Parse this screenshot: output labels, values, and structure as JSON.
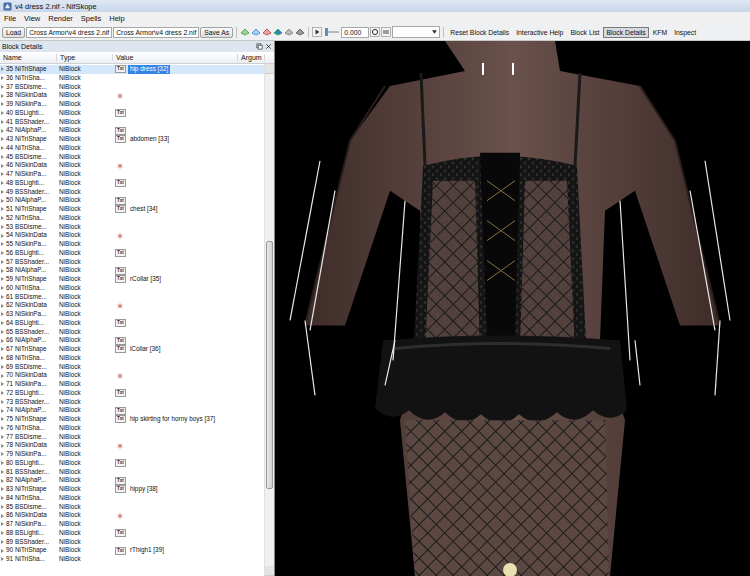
{
  "window": {
    "title": "v4 dress 2.nif - NifSkope"
  },
  "menu": [
    "File",
    "View",
    "Render",
    "Spells",
    "Help"
  ],
  "toolbar": {
    "load": "Load",
    "path": "Cross Armor\\v4 dress 2.nif",
    "path2": "Cross Armor\\v4 dress 2.nif",
    "save": "Save As",
    "time": "0.000",
    "time_level": 0,
    "views": [
      {
        "label": "Reset Block Details",
        "selected": false
      },
      {
        "label": "Interactive Help",
        "selected": false
      },
      {
        "label": "Block List",
        "selected": false
      },
      {
        "label": "Block Details",
        "selected": true
      },
      {
        "label": "KFM",
        "selected": false
      },
      {
        "label": "Inspect",
        "selected": false
      }
    ]
  },
  "panel": {
    "title": "Block Details",
    "columns": [
      "Name",
      "Type",
      "Value",
      "Argum"
    ],
    "scrollbar": {
      "offset": 0.34,
      "size": 0.5
    },
    "rows": [
      {
        "num": "35",
        "name": "NiTriShape",
        "type": "NiBlock",
        "kind": "txt",
        "tag": "Txt",
        "value": "hip dress [32]",
        "selected": true
      },
      {
        "num": "36",
        "name": "NiTriSha...",
        "type": "NiBlock",
        "kind": "none",
        "selected": false
      },
      {
        "num": "37",
        "name": "BSDisme...",
        "type": "NiBlock",
        "kind": "none",
        "selected": false
      },
      {
        "num": "38",
        "name": "NiSkinData",
        "type": "NiBlock",
        "kind": "skin",
        "selected": false
      },
      {
        "num": "39",
        "name": "NiSkinPa...",
        "type": "NiBlock",
        "kind": "none",
        "selected": false
      },
      {
        "num": "40",
        "name": "BSLighti...",
        "type": "NiBlock",
        "kind": "txt",
        "tag": "Txt",
        "selected": false
      },
      {
        "num": "41",
        "name": "BSShader...",
        "type": "NiBlock",
        "kind": "none",
        "selected": false
      },
      {
        "num": "42",
        "name": "NiAlphaP...",
        "type": "NiBlock",
        "kind": "txt",
        "tag": "Txt",
        "selected": false
      },
      {
        "num": "43",
        "name": "NiTriShape",
        "type": "NiBlock",
        "kind": "txt",
        "tag": "Txt",
        "value": "abdomen [33]",
        "selected": false
      },
      {
        "num": "44",
        "name": "NiTriSha...",
        "type": "NiBlock",
        "kind": "none",
        "selected": false
      },
      {
        "num": "45",
        "name": "BSDisme...",
        "type": "NiBlock",
        "kind": "none",
        "selected": false
      },
      {
        "num": "46",
        "name": "NiSkinData",
        "type": "NiBlock",
        "kind": "skin",
        "selected": false
      },
      {
        "num": "47",
        "name": "NiSkinPa...",
        "type": "NiBlock",
        "kind": "none",
        "selected": false
      },
      {
        "num": "48",
        "name": "BSLighti...",
        "type": "NiBlock",
        "kind": "txt",
        "tag": "Txt",
        "selected": false
      },
      {
        "num": "49",
        "name": "BSShader...",
        "type": "NiBlock",
        "kind": "none",
        "selected": false
      },
      {
        "num": "50",
        "name": "NiAlphaP...",
        "type": "NiBlock",
        "kind": "txt",
        "tag": "Txt",
        "selected": false
      },
      {
        "num": "51",
        "name": "NiTriShape",
        "type": "NiBlock",
        "kind": "txt",
        "tag": "Txt",
        "value": "chest [34]",
        "selected": false
      },
      {
        "num": "52",
        "name": "NiTriSha...",
        "type": "NiBlock",
        "kind": "none",
        "selected": false
      },
      {
        "num": "53",
        "name": "BSDisme...",
        "type": "NiBlock",
        "kind": "none",
        "selected": false
      },
      {
        "num": "54",
        "name": "NiSkinData",
        "type": "NiBlock",
        "kind": "skin",
        "selected": false
      },
      {
        "num": "55",
        "name": "NiSkinPa...",
        "type": "NiBlock",
        "kind": "none",
        "selected": false
      },
      {
        "num": "56",
        "name": "BSLighti...",
        "type": "NiBlock",
        "kind": "txt",
        "tag": "Txt",
        "selected": false
      },
      {
        "num": "57",
        "name": "BSShader...",
        "type": "NiBlock",
        "kind": "none",
        "selected": false
      },
      {
        "num": "58",
        "name": "NiAlphaP...",
        "type": "NiBlock",
        "kind": "txt",
        "tag": "Txt",
        "selected": false
      },
      {
        "num": "59",
        "name": "NiTriShape",
        "type": "NiBlock",
        "kind": "txt",
        "tag": "Txt",
        "value": "rCollar [35]",
        "selected": false
      },
      {
        "num": "60",
        "name": "NiTriSha...",
        "type": "NiBlock",
        "kind": "none",
        "selected": false
      },
      {
        "num": "61",
        "name": "BSDisme...",
        "type": "NiBlock",
        "kind": "none",
        "selected": false
      },
      {
        "num": "62",
        "name": "NiSkinData",
        "type": "NiBlock",
        "kind": "skin",
        "selected": false
      },
      {
        "num": "63",
        "name": "NiSkinPa...",
        "type": "NiBlock",
        "kind": "none",
        "selected": false
      },
      {
        "num": "64",
        "name": "BSLighti...",
        "type": "NiBlock",
        "kind": "txt",
        "tag": "Txt",
        "selected": false
      },
      {
        "num": "65",
        "name": "BSShader...",
        "type": "NiBlock",
        "kind": "none",
        "selected": false
      },
      {
        "num": "66",
        "name": "NiAlphaP...",
        "type": "NiBlock",
        "kind": "txt",
        "tag": "Txt",
        "selected": false
      },
      {
        "num": "67",
        "name": "NiTriShape",
        "type": "NiBlock",
        "kind": "txt",
        "tag": "Txt",
        "value": "lCollar [36]",
        "selected": false
      },
      {
        "num": "68",
        "name": "NiTriSha...",
        "type": "NiBlock",
        "kind": "none",
        "selected": false
      },
      {
        "num": "69",
        "name": "BSDisme...",
        "type": "NiBlock",
        "kind": "none",
        "selected": false
      },
      {
        "num": "70",
        "name": "NiSkinData",
        "type": "NiBlock",
        "kind": "skin",
        "selected": false
      },
      {
        "num": "71",
        "name": "NiSkinPa...",
        "type": "NiBlock",
        "kind": "none",
        "selected": false
      },
      {
        "num": "72",
        "name": "BSLighti...",
        "type": "NiBlock",
        "kind": "txt",
        "tag": "Txt",
        "selected": false
      },
      {
        "num": "73",
        "name": "BSShader...",
        "type": "NiBlock",
        "kind": "none",
        "selected": false
      },
      {
        "num": "74",
        "name": "NiAlphaP...",
        "type": "NiBlock",
        "kind": "txt",
        "tag": "Txt",
        "selected": false
      },
      {
        "num": "75",
        "name": "NiTriShape",
        "type": "NiBlock",
        "kind": "txt",
        "tag": "Txt",
        "value": "hip skirting for horny boys [37]",
        "selected": false
      },
      {
        "num": "76",
        "name": "NiTriSha...",
        "type": "NiBlock",
        "kind": "none",
        "selected": false
      },
      {
        "num": "77",
        "name": "BSDisme...",
        "type": "NiBlock",
        "kind": "none",
        "selected": false
      },
      {
        "num": "78",
        "name": "NiSkinData",
        "type": "NiBlock",
        "kind": "skin",
        "selected": false
      },
      {
        "num": "79",
        "name": "NiSkinPa...",
        "type": "NiBlock",
        "kind": "none",
        "selected": false
      },
      {
        "num": "80",
        "name": "BSLighti...",
        "type": "NiBlock",
        "kind": "txt",
        "tag": "Txt",
        "selected": false
      },
      {
        "num": "81",
        "name": "BSShader...",
        "type": "NiBlock",
        "kind": "none",
        "selected": false
      },
      {
        "num": "82",
        "name": "NiAlphaP...",
        "type": "NiBlock",
        "kind": "txt",
        "tag": "Txt",
        "selected": false
      },
      {
        "num": "83",
        "name": "NiTriShape",
        "type": "NiBlock",
        "kind": "txt",
        "tag": "Txt",
        "value": "hippy [38]",
        "selected": false
      },
      {
        "num": "84",
        "name": "NiTriSha...",
        "type": "NiBlock",
        "kind": "none",
        "selected": false
      },
      {
        "num": "85",
        "name": "BSDisme...",
        "type": "NiBlock",
        "kind": "none",
        "selected": false
      },
      {
        "num": "86",
        "name": "NiSkinData",
        "type": "NiBlock",
        "kind": "skin",
        "selected": false
      },
      {
        "num": "87",
        "name": "NiSkinPa...",
        "type": "NiBlock",
        "kind": "none",
        "selected": false
      },
      {
        "num": "88",
        "name": "BSLighti...",
        "type": "NiBlock",
        "kind": "txt",
        "tag": "Txt",
        "selected": false
      },
      {
        "num": "89",
        "name": "BSShader...",
        "type": "NiBlock",
        "kind": "none",
        "selected": false
      },
      {
        "num": "90",
        "name": "NiTriShape",
        "type": "NiBlock",
        "kind": "txt",
        "tag": "Txt",
        "value": "rThigh1 [39]",
        "selected": false
      },
      {
        "num": "91",
        "name": "NiTriSha...",
        "type": "NiBlock",
        "kind": "none",
        "selected": false
      }
    ]
  }
}
